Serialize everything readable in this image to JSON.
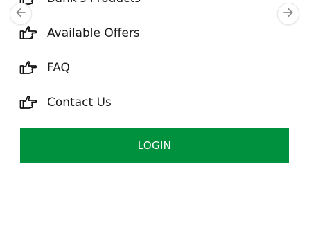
{
  "menu": {
    "items": [
      {
        "label": "Bank's Products",
        "icon": "pointing-hand-icon"
      },
      {
        "label": "Available Offers",
        "icon": "pointing-hand-icon"
      },
      {
        "label": "FAQ",
        "icon": "pointing-hand-icon"
      },
      {
        "label": "Contact Us",
        "icon": "pointing-hand-icon"
      }
    ]
  },
  "carousel": {
    "prev_icon": "arrow-left-icon",
    "next_icon": "arrow-right-icon"
  },
  "login": {
    "label": "LOGIN"
  },
  "colors": {
    "login_background": "#00913f",
    "text": "#1a1a1a",
    "arrow": "#8c8c8c",
    "icon_stroke": "#111111"
  }
}
